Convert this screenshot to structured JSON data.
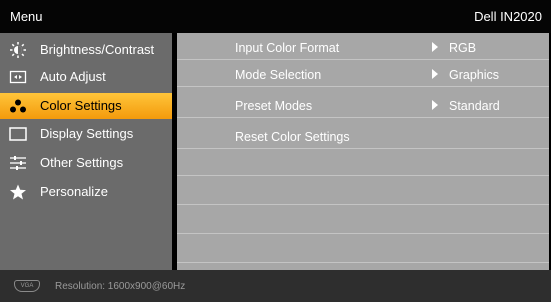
{
  "header": {
    "menu_label": "Menu",
    "model": "Dell IN2020"
  },
  "left_menu": {
    "items": [
      {
        "label": "Brightness/Contrast",
        "icon": "brightness-icon",
        "selected": false
      },
      {
        "label": "Auto Adjust",
        "icon": "auto-adjust-icon",
        "selected": false
      },
      {
        "label": "Color Settings",
        "icon": "color-settings-icon",
        "selected": true
      },
      {
        "label": "Display Settings",
        "icon": "display-settings-icon",
        "selected": false
      },
      {
        "label": "Other Settings",
        "icon": "other-settings-icon",
        "selected": false
      },
      {
        "label": "Personalize",
        "icon": "star-icon",
        "selected": false
      }
    ]
  },
  "submenu": {
    "rows": [
      {
        "label": "Input Color Format",
        "value": "RGB"
      },
      {
        "label": "Mode Selection",
        "value": "Graphics"
      },
      {
        "label": "Preset Modes",
        "value": "Standard"
      },
      {
        "label": "Reset Color Settings",
        "value": ""
      }
    ]
  },
  "footer": {
    "connector": "VGA",
    "resolution": "Resolution:  1600x900@60Hz"
  },
  "colors": {
    "highlight_top": "#ffc53a",
    "highlight_bottom": "#f39a0c",
    "left_panel": "#6b6b6b",
    "right_panel": "#a7a7a7"
  }
}
